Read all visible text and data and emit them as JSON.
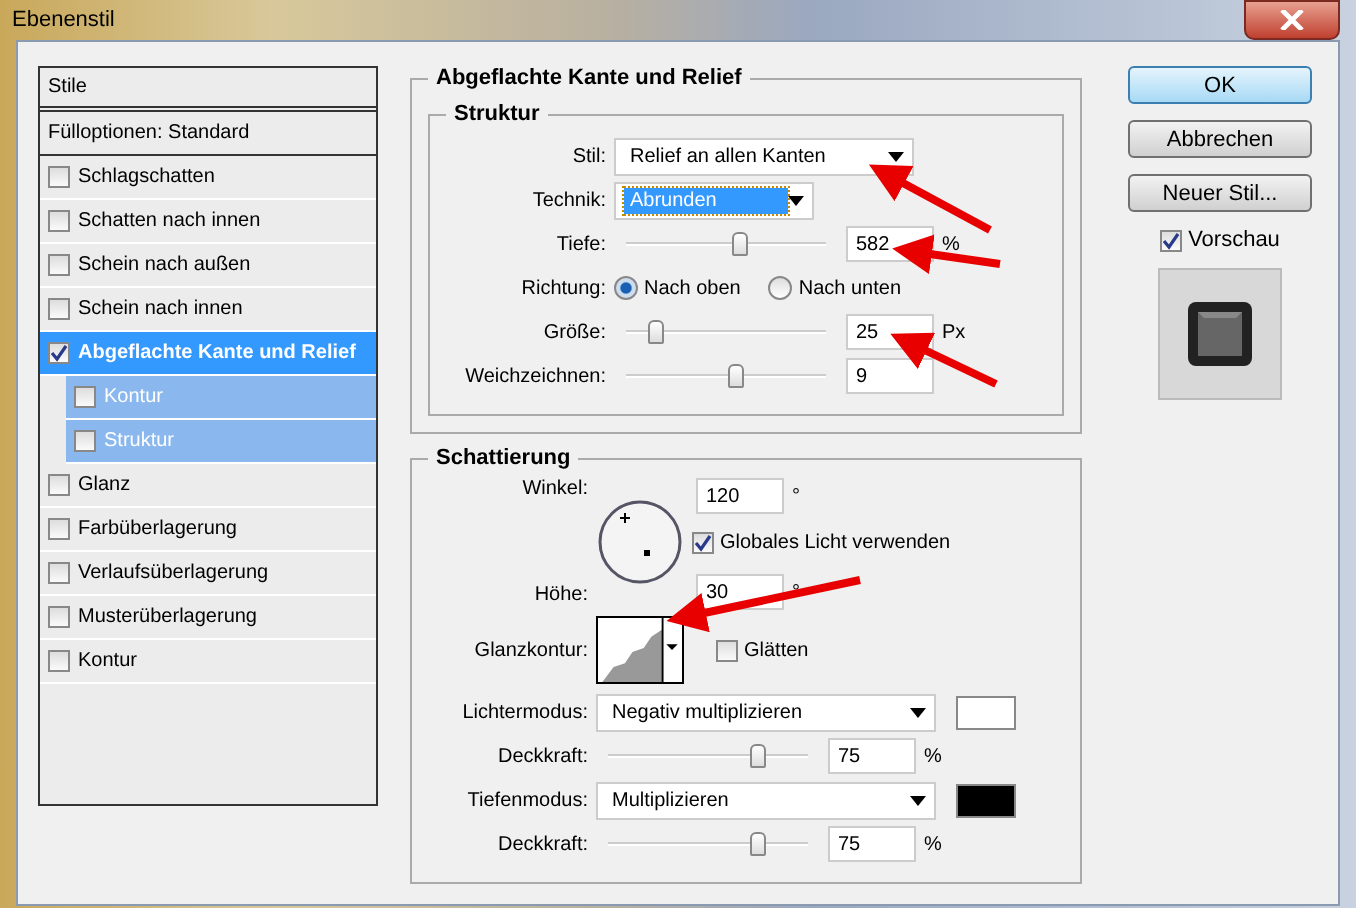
{
  "window": {
    "title": "Ebenenstil"
  },
  "styles_panel": {
    "header": "Stile",
    "blend_options": "Fülloptionen: Standard",
    "items": [
      {
        "label": "Schlagschatten",
        "checked": false,
        "selected": false
      },
      {
        "label": "Schatten nach innen",
        "checked": false,
        "selected": false
      },
      {
        "label": "Schein nach außen",
        "checked": false,
        "selected": false
      },
      {
        "label": "Schein nach innen",
        "checked": false,
        "selected": false
      },
      {
        "label": "Abgeflachte Kante und Relief",
        "checked": true,
        "selected": true,
        "children": [
          {
            "label": "Kontur",
            "checked": false
          },
          {
            "label": "Struktur",
            "checked": false
          }
        ]
      },
      {
        "label": "Glanz",
        "checked": false,
        "selected": false
      },
      {
        "label": "Farbüberlagerung",
        "checked": false,
        "selected": false
      },
      {
        "label": "Verlaufsüberlagerung",
        "checked": false,
        "selected": false
      },
      {
        "label": "Musterüberlagerung",
        "checked": false,
        "selected": false
      },
      {
        "label": "Kontur",
        "checked": false,
        "selected": false
      }
    ]
  },
  "main": {
    "title": "Abgeflachte Kante und Relief",
    "structure": {
      "title": "Struktur",
      "rows": [
        {
          "kind": "select",
          "label": "Stil:",
          "value": "Relief an allen Kanten",
          "highlighted": false,
          "wide": true
        },
        {
          "kind": "select",
          "label": "Technik:",
          "value": "Abrunden",
          "highlighted": true,
          "wide": false
        },
        {
          "kind": "slider",
          "label": "Tiefe:",
          "level": 0.57,
          "value": "582",
          "unit": "%"
        },
        {
          "kind": "radio",
          "label": "Richtung:",
          "options": [
            {
              "label": "Nach oben",
              "selected": true
            },
            {
              "label": "Nach unten",
              "selected": false
            }
          ]
        },
        {
          "kind": "slider",
          "label": "Größe:",
          "level": 0.15,
          "value": "25",
          "unit": "Px"
        },
        {
          "kind": "slider",
          "label": "Weichzeichnen:",
          "level": 0.55,
          "value": "9"
        }
      ]
    },
    "shading": {
      "title": "Schattierung",
      "angle_label": "Winkel:",
      "angle_value": "120",
      "angle_unit": "°",
      "global_light": {
        "label": "Globales Licht verwenden",
        "checked": true
      },
      "altitude_label": "Höhe:",
      "altitude_value": "30",
      "altitude_unit": "°",
      "gloss_label": "Glanzkontur:",
      "smooth": {
        "label": "Glätten",
        "checked": false
      },
      "rows": [
        {
          "kind": "mode",
          "label": "Lichtermodus:",
          "value": "Negativ multiplizieren",
          "color": "#ffffff"
        },
        {
          "kind": "slider",
          "label": "Deckkraft:",
          "level": 0.75,
          "value": "75",
          "unit": "%"
        },
        {
          "kind": "mode",
          "label": "Tiefenmodus:",
          "value": "Multiplizieren",
          "color": "#000000"
        },
        {
          "kind": "slider",
          "label": "Deckkraft:",
          "level": 0.75,
          "value": "75",
          "unit": "%"
        }
      ]
    }
  },
  "buttons": [
    {
      "label": "OK",
      "default": true
    },
    {
      "label": "Abbrechen",
      "default": false
    },
    {
      "label": "Neuer Stil...",
      "default": false
    }
  ],
  "preview": {
    "label": "Vorschau",
    "checked": true
  }
}
